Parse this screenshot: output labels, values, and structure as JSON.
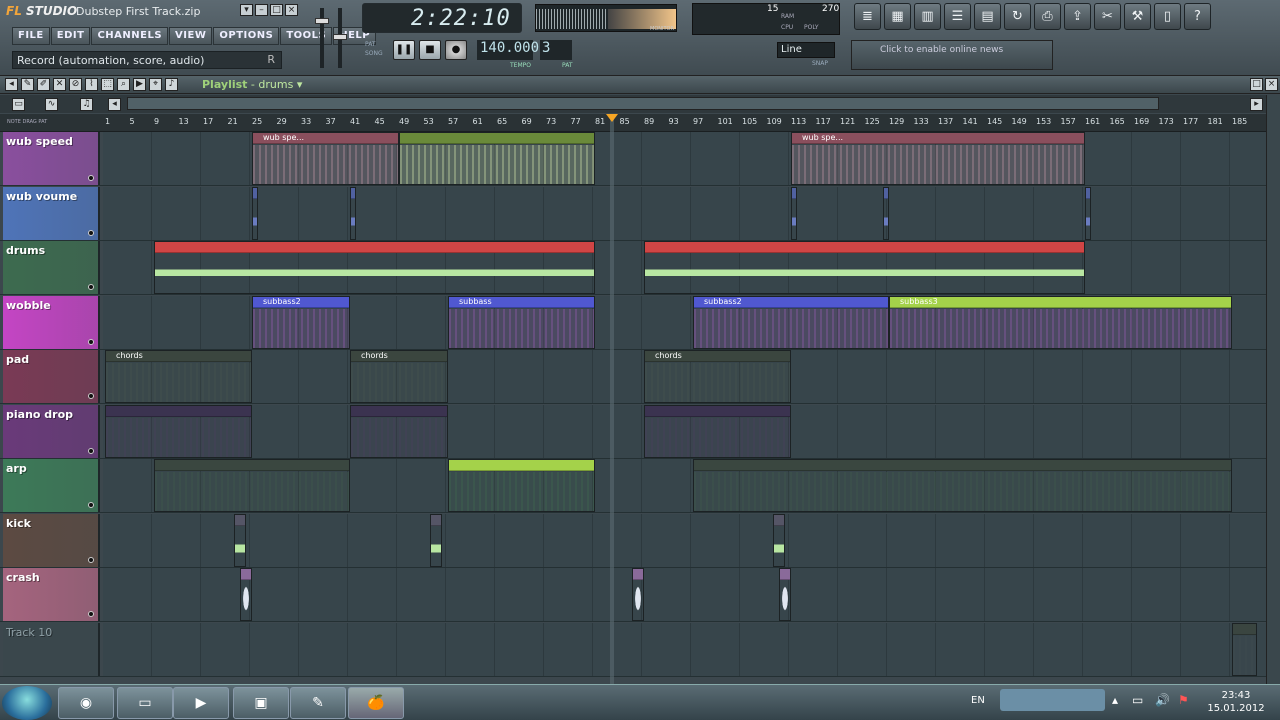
{
  "app": {
    "logo_main": "FL STUDIO",
    "logo_fl": "FL",
    "project": "Dubstep First Track.zip"
  },
  "menu": [
    "FILE",
    "EDIT",
    "CHANNELS",
    "VIEW",
    "OPTIONS",
    "TOOLS",
    "HELP"
  ],
  "hint": {
    "text": "Record (automation, score, audio)",
    "shortcut": "R"
  },
  "transport": {
    "time": "2:22:10",
    "tempo": "140.000",
    "tempo_label": "TEMPO",
    "pattern": "3",
    "pattern_label": "PAT",
    "pat_label": "PAT",
    "song_label": "SONG"
  },
  "monitor": {
    "label": "MONITOR"
  },
  "cpu": {
    "value": "15",
    "poly": "270",
    "ram_label": "RAM",
    "cpu_label": "CPU",
    "poly_label": "POLY"
  },
  "snap": {
    "value": "Line",
    "label": "SNAP"
  },
  "news": {
    "text": "Click to enable online news"
  },
  "playlist": {
    "title": "Playlist",
    "name": "drums",
    "ruler_labels": [
      "NOTE",
      "DRAG",
      "PAT"
    ]
  },
  "ruler": [
    1,
    5,
    9,
    13,
    17,
    21,
    25,
    29,
    33,
    37,
    41,
    45,
    49,
    53,
    57,
    61,
    65,
    69,
    73,
    77,
    81,
    85,
    89,
    93,
    97,
    101,
    105,
    109,
    113,
    117,
    121,
    125,
    129,
    133,
    137,
    141,
    145,
    149,
    153,
    157,
    161,
    165,
    169,
    173,
    177,
    181,
    185
  ],
  "tracks": [
    {
      "name": "wub speed",
      "color": "#8a4f9e"
    },
    {
      "name": "wub voume",
      "color": "#4f74b8"
    },
    {
      "name": "drums",
      "color": "#3d6b4f"
    },
    {
      "name": "wobble",
      "color": "#c445c4"
    },
    {
      "name": "pad",
      "color": "#7a3a55"
    },
    {
      "name": "piano drop",
      "color": "#6a3a7a"
    },
    {
      "name": "arp",
      "color": "#3d7a58"
    },
    {
      "name": "kick",
      "color": "#5c4a42"
    },
    {
      "name": "crash",
      "color": "#a5647e"
    },
    {
      "name": "Track 10",
      "color": "#3a474c"
    }
  ],
  "clips": {
    "wub": "wub spe...",
    "subbass": "subbass",
    "subbass2": "subbass2",
    "subbass3": "subbass3",
    "chords": "chords"
  },
  "taskbar": {
    "lang": "EN",
    "time": "23:43",
    "date": "15.01.2012"
  }
}
